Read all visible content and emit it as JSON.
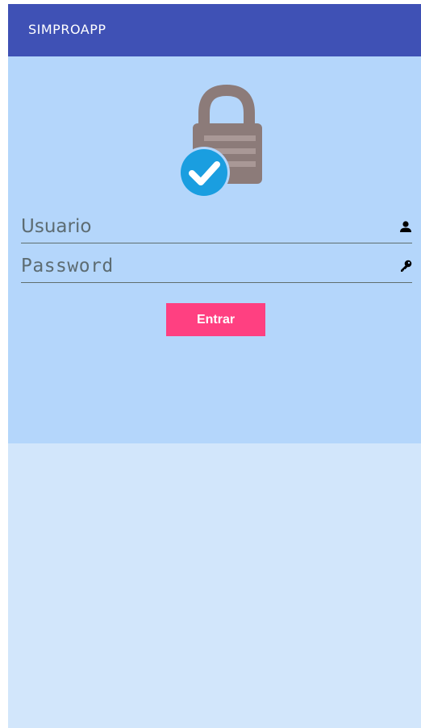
{
  "app_bar": {
    "title": "SIMPROAPP",
    "color": "#3f51b5"
  },
  "login": {
    "logo_icon": "lock-check-icon",
    "username": {
      "placeholder": "Usuario",
      "value": "",
      "icon": "person-icon"
    },
    "password": {
      "placeholder": "Password",
      "value": "",
      "icon": "key-icon"
    },
    "submit_label": "Entrar"
  },
  "colors": {
    "accent": "#ff4081",
    "panel_background": "#b4d6fb",
    "page_background": "#d2e6fb",
    "check_badge": "#1a9ee0"
  }
}
